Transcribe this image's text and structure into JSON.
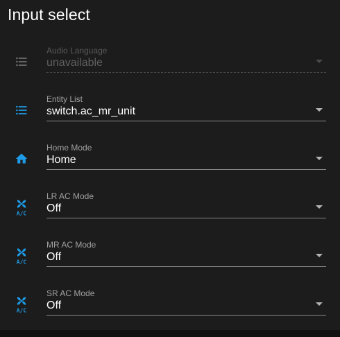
{
  "card": {
    "title": "Input select"
  },
  "colors": {
    "accent": "#1e9be6",
    "disabled_icon": "#6f6f6f"
  },
  "entities": [
    {
      "label": "Audio Language",
      "value": "unavailable",
      "icon": "format-list-bulleted-icon",
      "disabled": true
    },
    {
      "label": "Entity List",
      "value": "switch.ac_mr_unit",
      "icon": "format-list-bulleted-icon",
      "disabled": false
    },
    {
      "label": "Home Mode",
      "value": "Home",
      "icon": "home-icon",
      "disabled": false
    },
    {
      "label": "LR AC Mode",
      "value": "Off",
      "icon": "air-conditioner-icon",
      "disabled": false
    },
    {
      "label": "MR AC Mode",
      "value": "Off",
      "icon": "air-conditioner-icon",
      "disabled": false
    },
    {
      "label": "SR AC Mode",
      "value": "Off",
      "icon": "air-conditioner-icon",
      "disabled": false
    }
  ]
}
